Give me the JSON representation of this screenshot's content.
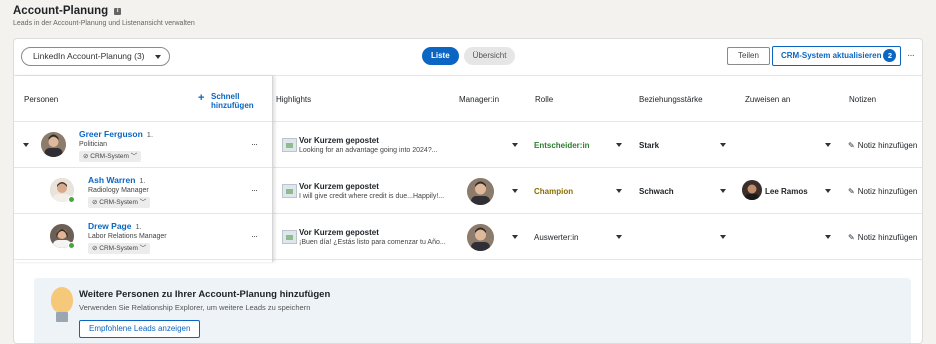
{
  "header": {
    "title": "Account-Planung",
    "info_icon": "i",
    "subtitle": "Leads in der Account-Planung und Listenansicht verwalten"
  },
  "toolbar": {
    "list_select": "LinkedIn Account-Planung (3)",
    "view_list": "Liste",
    "view_overview": "Übersicht",
    "share": "Teilen",
    "crm_update": "CRM-System aktualisieren",
    "crm_count": "2",
    "more": "···"
  },
  "columns": {
    "persons": "Personen",
    "quick_add_line1": "Schnell",
    "quick_add_line2": "hinzufügen",
    "highlights": "Highlights",
    "manager": "Manager:in",
    "role": "Rolle",
    "strength": "Beziehungsstärke",
    "assign": "Zuweisen an",
    "notes": "Notizen"
  },
  "rows": [
    {
      "name": "Greer Ferguson",
      "degree": "1.",
      "title": "Politician",
      "crm": "CRM-System",
      "highlight_title": "Vor Kurzem gepostet",
      "highlight_text": "Looking for an advantage going into 2024?...",
      "role": "Entscheider:in",
      "role_color": "#2e7d32",
      "strength": "Stark",
      "assignee": "",
      "note": "Notiz hinzufügen",
      "more": "···"
    },
    {
      "name": "Ash Warren",
      "degree": "1.",
      "title": "Radiology Manager",
      "crm": "CRM-System",
      "highlight_title": "Vor Kurzem gepostet",
      "highlight_text": "I will give credit where credit is due...Happily!...",
      "role": "Champion",
      "role_color": "#8a6d00",
      "strength": "Schwach",
      "assignee": "Lee Ramos",
      "note": "Notiz hinzufügen",
      "more": "···"
    },
    {
      "name": "Drew Page",
      "degree": "1.",
      "title": "Labor Relations Manager",
      "crm": "CRM-System",
      "highlight_title": "Vor Kurzem gepostet",
      "highlight_text": "¡Buen día! ¿Estás listo para comenzar tu Año...",
      "role": "Auswerter:in",
      "role_color": "#1d2226",
      "strength": "",
      "assignee": "",
      "note": "Notiz hinzufügen",
      "more": "···"
    }
  ],
  "promo": {
    "title": "Weitere Personen zu Ihrer Account-Planung hinzufügen",
    "subtitle": "Verwenden Sie Relationship Explorer, um weitere Leads zu speichern",
    "button": "Empfohlene Leads anzeigen"
  },
  "colors": {
    "accent": "#0a66c2",
    "online": "#44a83f"
  }
}
